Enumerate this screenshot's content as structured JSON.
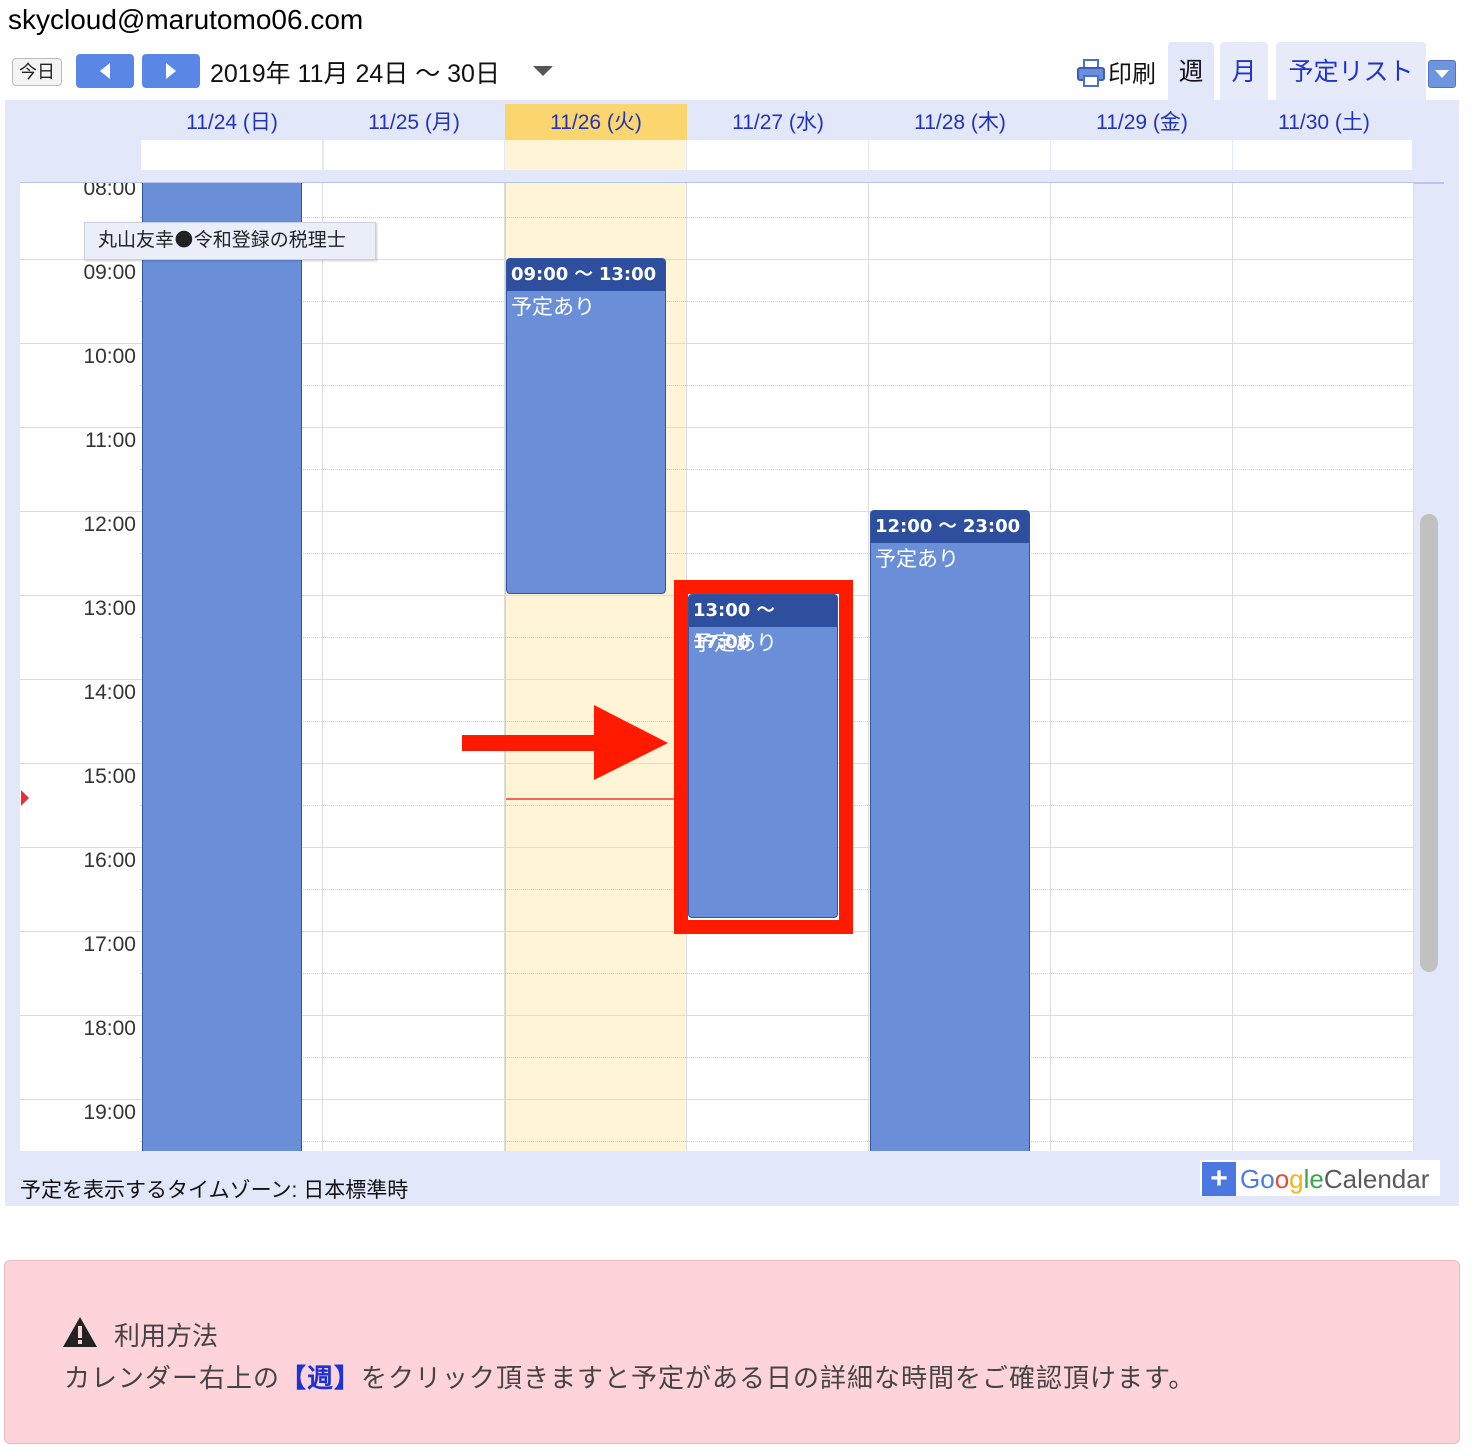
{
  "header": {
    "email": "skycloud@marutomo06.com",
    "today_label": "今日",
    "date_range": "2019年 11月 24日 〜 30日",
    "print_label": "印刷",
    "tabs": [
      "週",
      "月",
      "予定リスト"
    ]
  },
  "days": [
    "11/24 (日)",
    "11/25 (月)",
    "11/26 (火)",
    "11/27 (水)",
    "11/28 (木)",
    "11/29 (金)",
    "11/30 (土)"
  ],
  "highlighted_day": "11/26 (火)",
  "times": [
    "08:00",
    "09:00",
    "10:00",
    "11:00",
    "12:00",
    "13:00",
    "14:00",
    "15:00",
    "16:00",
    "17:00",
    "18:00",
    "19:00"
  ],
  "events": [
    {
      "day": "11/24 (日)",
      "time": "",
      "title": ""
    },
    {
      "day": "11/26 (火)",
      "time": "09:00 〜 13:00",
      "title": "予定あり"
    },
    {
      "day": "11/27 (水)",
      "time": "13:00 〜 17:00",
      "title": "予定あり"
    },
    {
      "day": "11/28 (木)",
      "time": "12:00 〜 23:00",
      "title": "予定あり"
    }
  ],
  "tooltip": "丸山友幸🌑令和登録の税理士",
  "timezone_label": "予定を表示するタイムゾーン: 日本標準時",
  "gcal": {
    "plus": "+",
    "g1": "Go",
    "g2": "o",
    "g3": "g",
    "g4": "le",
    "cal": "Calendar"
  },
  "notice": {
    "title": "利用方法",
    "body_pre": "カレンダー右上の",
    "body_highlight": "【週】",
    "body_post": "をクリック頂きますと予定がある日の詳細な時間をご確認頂けます。"
  },
  "colors": {
    "event": "#6a8fd8",
    "event_header": "#2e4f9e",
    "today_column": "#fff4d6",
    "annotation": "#ff1a00",
    "notice_bg": "#ffd3da"
  }
}
